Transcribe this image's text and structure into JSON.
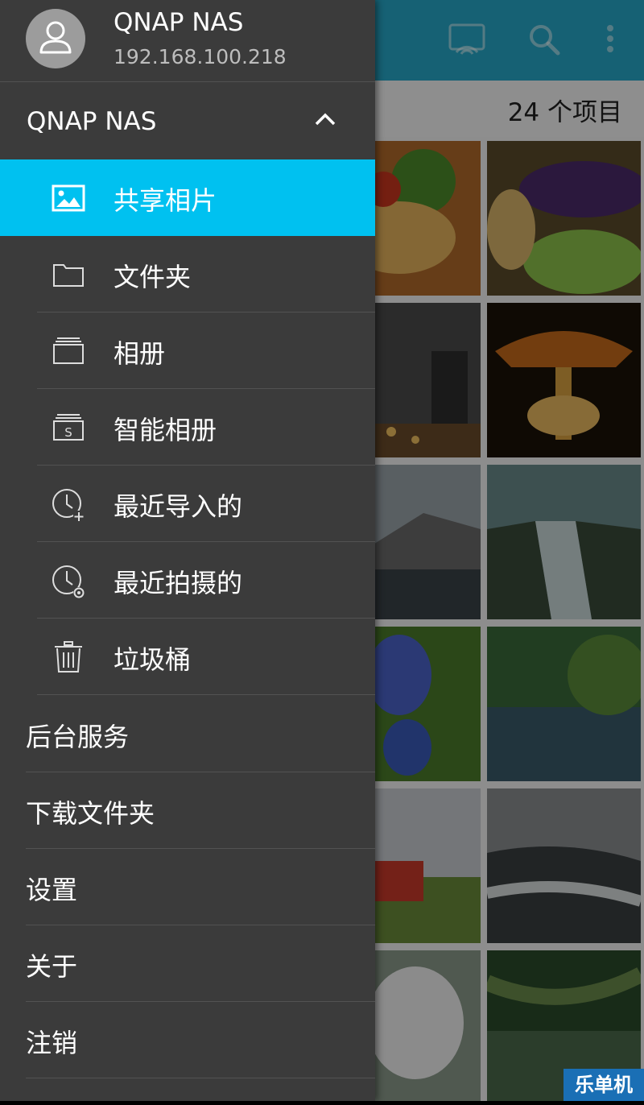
{
  "background": {
    "item_count": "24 个项目",
    "topbar_color": "#27a8c8",
    "icons": [
      "cast-icon",
      "search-icon",
      "more-vertical-icon"
    ],
    "watermark": "乐单机"
  },
  "drawer": {
    "device_name": "QNAP NAS",
    "device_ip": "192.168.100.218",
    "section_title": "QNAP NAS",
    "active_color": "#00c1f0",
    "nav_items": [
      {
        "label": "共享相片",
        "icon": "image-icon"
      },
      {
        "label": "文件夹",
        "icon": "folder-icon"
      },
      {
        "label": "相册",
        "icon": "album-icon"
      },
      {
        "label": "智能相册",
        "icon": "smart-album-icon"
      },
      {
        "label": "最近导入的",
        "icon": "recent-import-icon"
      },
      {
        "label": "最近拍摄的",
        "icon": "recent-taken-icon"
      },
      {
        "label": "垃圾桶",
        "icon": "trash-icon"
      }
    ],
    "main_items": [
      {
        "label": "后台服务"
      },
      {
        "label": "下载文件夹"
      },
      {
        "label": "设置"
      },
      {
        "label": "关于"
      },
      {
        "label": "注销"
      }
    ]
  }
}
